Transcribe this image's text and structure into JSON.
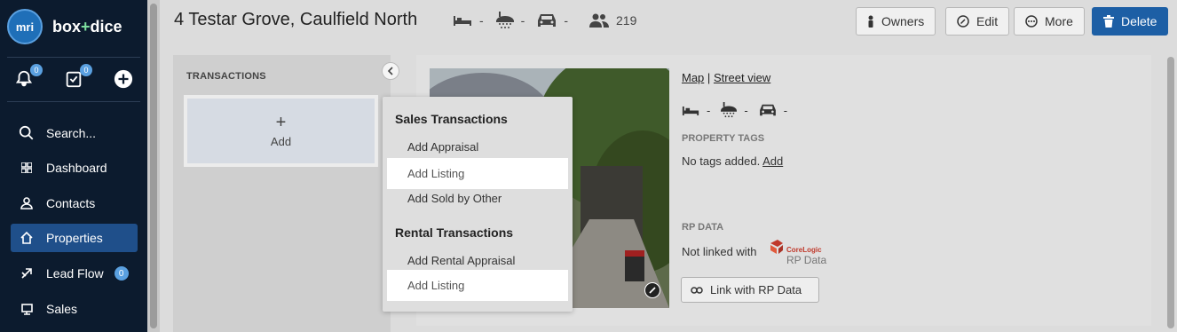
{
  "sidebar": {
    "logo_mark": "mri",
    "brand_part1": "box",
    "brand_plus": "+",
    "brand_part2": "dice",
    "notifications_count": "0",
    "tasks_count": "0",
    "nav": [
      {
        "label": "Search...",
        "icon": "search-icon"
      },
      {
        "label": "Dashboard",
        "icon": "grid-icon"
      },
      {
        "label": "Contacts",
        "icon": "person-icon"
      },
      {
        "label": "Properties",
        "icon": "house-icon",
        "active": true
      },
      {
        "label": "Lead Flow",
        "icon": "lead-flow-icon",
        "badge": "0"
      },
      {
        "label": "Sales",
        "icon": "sales-icon"
      }
    ]
  },
  "header": {
    "address": "4 Testar Grove, Caulfield North",
    "bed": "-",
    "bath": "-",
    "car": "-",
    "owners_count": "219",
    "buttons": {
      "owners": "Owners",
      "edit": "Edit",
      "more": "More",
      "delete": "Delete"
    },
    "delete_color": "#1d5fa5"
  },
  "transactions": {
    "title": "TRANSACTIONS",
    "add_plus": "+",
    "add_label": "Add"
  },
  "menu": {
    "sales_heading": "Sales Transactions",
    "sales_items": [
      "Add Appraisal",
      "Add Listing",
      "Add Sold by Other"
    ],
    "rental_heading": "Rental Transactions",
    "rental_items": [
      "Add Rental Appraisal",
      "Add Listing"
    ]
  },
  "property": {
    "map_link": "Map",
    "separator": "|",
    "street_view_link": "Street view",
    "bed": "-",
    "bath": "-",
    "car": "-",
    "tags_label": "PROPERTY TAGS",
    "tags_text": "No tags added.",
    "tags_add": "Add",
    "rp_label": "RP DATA",
    "rp_text": "Not linked with",
    "corelogic_name": "CoreLogic",
    "rp_data_logo_text": "RP Data",
    "rp_button": "Link with RP Data"
  }
}
